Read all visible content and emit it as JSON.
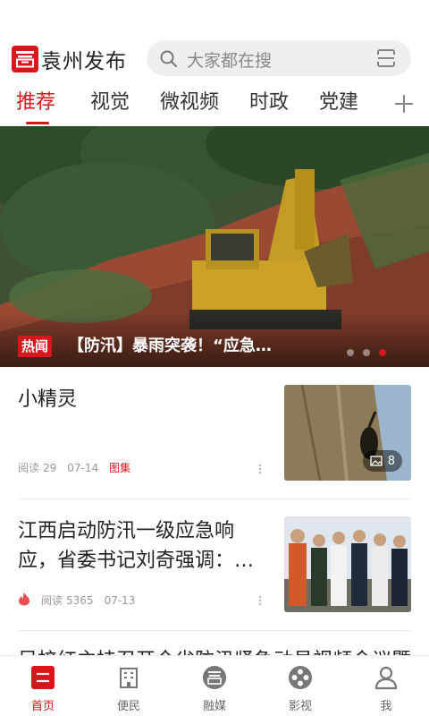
{
  "header": {
    "app_name": "袁州发布",
    "search_placeholder": "大家都在搜"
  },
  "tabs": [
    {
      "label": "推荐",
      "active": true
    },
    {
      "label": "视觉"
    },
    {
      "label": "微视频"
    },
    {
      "label": "时政"
    },
    {
      "label": "党建"
    }
  ],
  "banner": {
    "badge": "热闻",
    "title": "【防汛】暴雨突袭！“应急…",
    "slide_count": 3,
    "active_slide": 3
  },
  "articles": [
    {
      "title": "小精灵",
      "read_label": "阅读",
      "reads": "29",
      "date": "07-14",
      "tag": "图集",
      "image_count": "8"
    },
    {
      "title": "江西启动防汛一级应急响应，省委书记刘奇强调：…",
      "read_label": "阅读",
      "reads": "5365",
      "date": "07-13",
      "hot": true
    }
  ],
  "partial_article_title": "吴梓红主持召开全省防汛紧急动员视频会议暨…",
  "bottom_nav": [
    {
      "label": "首页",
      "icon": "home-icon",
      "active": true
    },
    {
      "label": "便民",
      "icon": "building-icon"
    },
    {
      "label": "融媒",
      "icon": "media-icon"
    },
    {
      "label": "影视",
      "icon": "film-reel-icon"
    },
    {
      "label": "我",
      "icon": "user-icon"
    }
  ],
  "colors": {
    "accent": "#d8161b",
    "text": "#222222",
    "muted": "#999999"
  }
}
